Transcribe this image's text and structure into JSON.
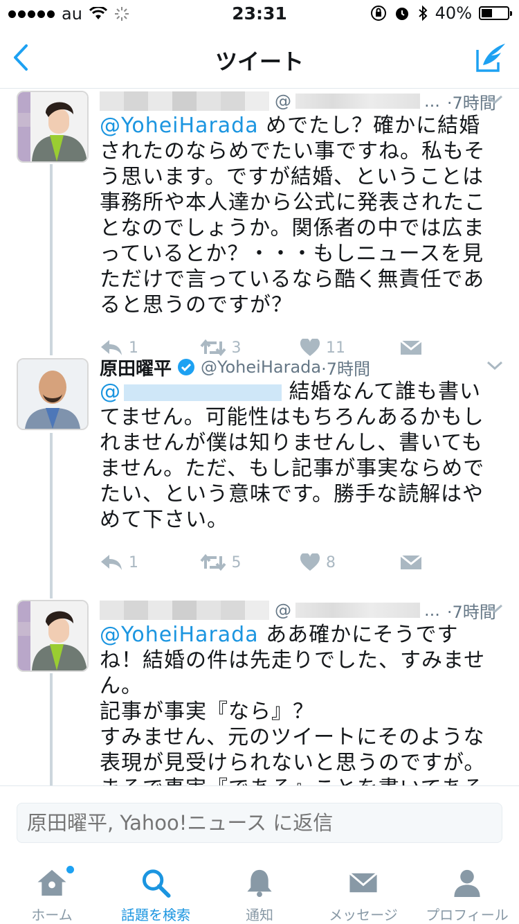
{
  "status_bar": {
    "carrier": "au",
    "time": "23:31",
    "battery": "40%"
  },
  "nav": {
    "title": "ツイート"
  },
  "tweets": [
    {
      "mention": "@YoheiHarada",
      "text": " めでたし？確かに結婚されたのならめでたい事ですね。私もそう思います。ですが結婚、ということは事務所や本人達から公式に発表されたことなのでしょうか。関係者の中では広まっているとか？・・・もしニュースを見ただけで言っているなら酷く無責任であると思うのですが？",
      "time": "·7時間",
      "at": "@",
      "ellipsis": "...",
      "replies": "1",
      "retweets": "3",
      "likes": "11"
    },
    {
      "name": "原田曜平",
      "handle": "@YoheiHarada",
      "time": "·7時間",
      "mention": "@",
      "text": " 結婚なんて誰も書いてません。可能性はもちろんあるかもしれませんが僕は知りませんし、書いてもません。ただ、もし記事が事実ならめでたい、という意味です。勝手な読解はやめて下さい。",
      "replies": "1",
      "retweets": "5",
      "likes": "8"
    },
    {
      "mention": "@YoheiHarada",
      "text": " ああ確かにそうですね！結婚の件は先走りでした、すみません。\n記事が事実『なら』？\nすみません、元のツイートにそのような表現が見受けられないと思うのですが。まるで事実『である』ことを書いてあるように",
      "time": "·7時間",
      "at": "@",
      "ellipsis": "..."
    }
  ],
  "reply": {
    "placeholder": "原田曜平, Yahoo!ニュース に返信"
  },
  "tabs": [
    {
      "label": "ホーム"
    },
    {
      "label": "話題を検索"
    },
    {
      "label": "通知"
    },
    {
      "label": "メッセージ"
    },
    {
      "label": "プロフィール"
    }
  ],
  "colors": {
    "accent": "#1b95e0",
    "muted": "#aab8c2",
    "text": "#14171a"
  },
  "icons": [
    "back-chevron-icon",
    "compose-icon",
    "reply-icon",
    "retweet-icon",
    "like-icon",
    "dm-icon",
    "home-icon",
    "search-icon",
    "bell-icon",
    "mail-icon",
    "person-icon",
    "verified-icon"
  ]
}
